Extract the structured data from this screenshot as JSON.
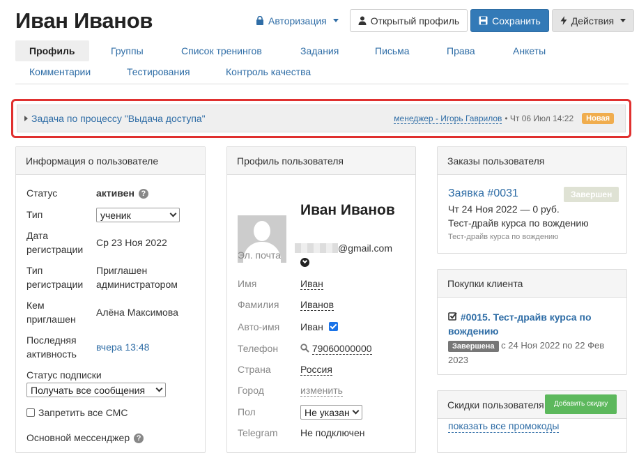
{
  "header": {
    "title": "Иван Иванов",
    "auth_label": "Авторизация",
    "open_profile_label": "Открытый профиль",
    "save_label": "Сохранить",
    "actions_label": "Действия"
  },
  "tabs": [
    {
      "label": "Профиль",
      "active": true
    },
    {
      "label": "Группы"
    },
    {
      "label": "Список тренингов"
    },
    {
      "label": "Задания"
    },
    {
      "label": "Письма"
    },
    {
      "label": "Права"
    },
    {
      "label": "Анкеты"
    },
    {
      "label": "Комментарии"
    },
    {
      "label": "Тестирования"
    },
    {
      "label": "Контроль качества"
    }
  ],
  "task": {
    "title": "Задача по процессу \"Выдача доступа\"",
    "manager": "менеджер - Игорь Гаврилов",
    "date": "Чт 06 Июл 14:22",
    "badge": "Новая"
  },
  "user_info": {
    "heading": "Информация о пользователе",
    "status_label": "Статус",
    "status_value": "активен",
    "type_label": "Тип",
    "type_value": "ученик",
    "regdate_label_1": "Дата",
    "regdate_label_2": "регистрации",
    "regdate_value": "Ср 23 Ноя 2022",
    "regtype_label_1": "Тип",
    "regtype_label_2": "регистрации",
    "regtype_value_1": "Приглашен",
    "regtype_value_2": "администратором",
    "invited_label_1": "Кем",
    "invited_label_2": "приглашен",
    "invited_value": "Алёна Максимова",
    "activity_label_1": "Последняя",
    "activity_label_2": "активность",
    "activity_value": "вчера 13:48",
    "subscription_label": "Статус подписки",
    "subscription_value": "Получать все сообщения",
    "sms_label": "Запретить все СМС",
    "messenger_label": "Основной мессенджер"
  },
  "profile": {
    "heading": "Профиль пользователя",
    "name": "Иван Иванов",
    "email_label": "Эл. почта",
    "email_suffix": "@gmail.com",
    "firstname_label": "Имя",
    "firstname_value": "Иван",
    "lastname_label": "Фамилия",
    "lastname_value": "Иванов",
    "autoname_label": "Авто-имя",
    "autoname_value": "Иван",
    "phone_label": "Телефон",
    "phone_value": "79060000000",
    "country_label": "Страна",
    "country_value": "Россия",
    "city_label": "Город",
    "city_value": "изменить",
    "gender_label": "Пол",
    "gender_value": "Не указан",
    "telegram_label": "Telegram",
    "telegram_value": "Не подключен"
  },
  "orders": {
    "heading": "Заказы пользователя",
    "title": "Заявка #0031",
    "badge": "Завершен",
    "date_line": "Чт 24 Ноя 2022 — 0 руб.",
    "course": "Тест-драйв курса по вождению",
    "course_small": "Тест-драйв курса по вождению"
  },
  "purchases": {
    "heading": "Покупки клиента",
    "title_1": "#0015. Тест-драйв курса по",
    "title_2": "вождению",
    "badge": "Завершена",
    "period_1": "с 24 Ноя 2022 по 22 Фев",
    "period_2": "2023"
  },
  "discounts": {
    "heading": "Скидки пользователя",
    "add_label": "Добавить скидку",
    "promo_link": "показать все промокоды"
  },
  "colors": {
    "accent": "#337ab7",
    "link": "#2f6da6",
    "task_border": "#e0302f",
    "badge_new": "#f0ad4e",
    "green": "#5cb85c"
  }
}
